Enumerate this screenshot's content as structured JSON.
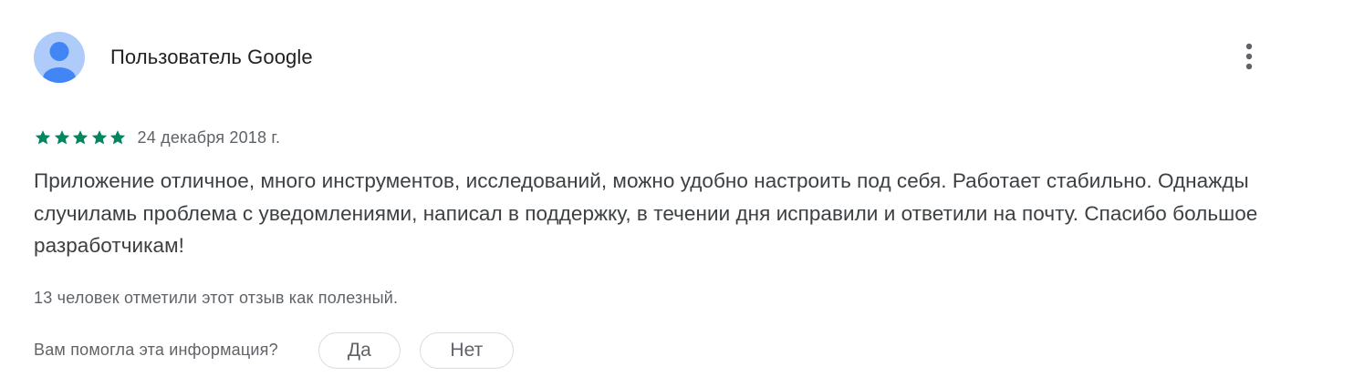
{
  "review": {
    "author": "Пользователь Google",
    "avatar_icon": "person-icon",
    "more_icon": "more-vert-icon",
    "rating": 5,
    "rating_max": 5,
    "star_color": "#01875f",
    "date": "24 декабря 2018 г.",
    "text": "Приложение отличное, много инструментов, исследований, можно удобно настроить под себя. Работает стабильно. Однажды случиламь проблема с уведомлениями, написал в поддержку, в течении дня исправили и ответили на почту. Спасибо большое разработчикам!",
    "helpful_count_text": "13 человек отметили этот отзыв как полезный."
  },
  "feedback": {
    "question": "Вам помогла эта информация?",
    "yes_label": "Да",
    "no_label": "Нет"
  },
  "colors": {
    "avatar_bg": "#aecbfa",
    "avatar_fg": "#4285f4",
    "text_primary": "#202124",
    "text_secondary": "#5f6368",
    "pill_border": "#dadce0"
  }
}
